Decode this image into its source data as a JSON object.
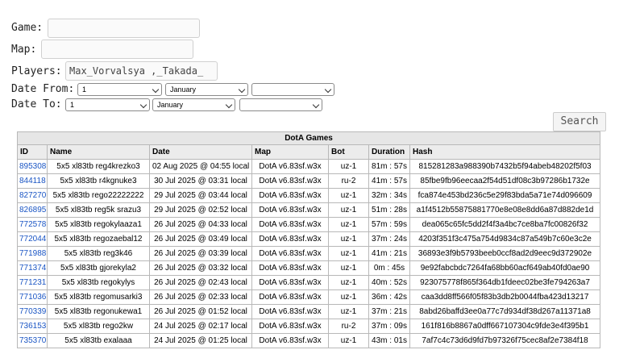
{
  "form": {
    "game_label": "Game:",
    "game_value": "",
    "map_label": "Map:",
    "map_value": "",
    "players_label": "Players:",
    "players_value": "Max_Vorvalsya ,_Takada_",
    "date_from_label": "Date From:",
    "date_from": {
      "day": "1",
      "month": "January",
      "year": ""
    },
    "date_to_label": "Date To:",
    "date_to": {
      "day": "1",
      "month": "January",
      "year": ""
    },
    "search_label": "Search"
  },
  "table": {
    "caption": "DotA Games",
    "headers": {
      "id": "ID",
      "name": "Name",
      "date": "Date",
      "map": "Map",
      "bot": "Bot",
      "duration": "Duration",
      "hash": "Hash"
    },
    "rows": [
      {
        "id": "895308",
        "name": "5x5 xl83tb reg4krezko3",
        "date": "02 Aug 2025 @ 04:55 local",
        "map": "DotA v6.83sf.w3x",
        "bot": "uz-1",
        "duration": "81m : 57s",
        "hash": "815281283a988390b7432b5f94abeb48202f5f03"
      },
      {
        "id": "844118",
        "name": "5x5 xl83tb r4kgnuke3",
        "date": "30 Jul 2025 @ 03:31 local",
        "map": "DotA v6.83sf.w3x",
        "bot": "ru-2",
        "duration": "41m : 57s",
        "hash": "85fbe9fb96eecaa2f54d51df08c3b97286b1732e"
      },
      {
        "id": "827270",
        "name": "5x5 xl83tb rego22222222",
        "date": "29 Jul 2025 @ 03:44 local",
        "map": "DotA v6.83sf.w3x",
        "bot": "uz-1",
        "duration": "32m : 34s",
        "hash": "fca874e453bd236c5e29f83bda5a71e74d096609"
      },
      {
        "id": "826895",
        "name": "5x5 xl83tb reg5k srazu3",
        "date": "29 Jul 2025 @ 02:52 local",
        "map": "DotA v6.83sf.w3x",
        "bot": "uz-1",
        "duration": "51m : 28s",
        "hash": "a1f4512b55875881770e8e08e8dd6a87d882de1d"
      },
      {
        "id": "772578",
        "name": "5x5 xl83tb regokylaaza1",
        "date": "26 Jul 2025 @ 04:33 local",
        "map": "DotA v6.83sf.w3x",
        "bot": "uz-1",
        "duration": "57m : 59s",
        "hash": "dea065c65fc5dd2f4f3a4bc7ce8ba7fc00826f32"
      },
      {
        "id": "772044",
        "name": "5x5 xl83tb regozaebal12",
        "date": "26 Jul 2025 @ 03:49 local",
        "map": "DotA v6.83sf.w3x",
        "bot": "uz-1",
        "duration": "37m : 24s",
        "hash": "4203f351f3c475a754d9834c87a549b7c60e3c2e"
      },
      {
        "id": "771988",
        "name": "5x5 xl83tb reg3k46",
        "date": "26 Jul 2025 @ 03:39 local",
        "map": "DotA v6.83sf.w3x",
        "bot": "uz-1",
        "duration": "41m : 21s",
        "hash": "36893e3f9b5793beeb0ccf8ad2d9eec9d372902e"
      },
      {
        "id": "771374",
        "name": "5x5 xl83tb gjorekyla2",
        "date": "26 Jul 2025 @ 03:32 local",
        "map": "DotA v6.83sf.w3x",
        "bot": "uz-1",
        "duration": "0m : 45s",
        "hash": "9e92fabcbdc7264fa68bb60acf649ab40fd0ae90"
      },
      {
        "id": "771231",
        "name": "5x5 xl83tb regokylys",
        "date": "26 Jul 2025 @ 02:43 local",
        "map": "DotA v6.83sf.w3x",
        "bot": "uz-1",
        "duration": "40m : 52s",
        "hash": "923075778f865f364db1fdeec02be3fe794263a7"
      },
      {
        "id": "771036",
        "name": "5x5 xl83tb regomusarki3",
        "date": "26 Jul 2025 @ 02:33 local",
        "map": "DotA v6.83sf.w3x",
        "bot": "uz-1",
        "duration": "36m : 42s",
        "hash": "caa3dd8ff566f05f83b3db2b0044fba423d13217"
      },
      {
        "id": "770339",
        "name": "5x5 xl83tb regonukewa1",
        "date": "26 Jul 2025 @ 01:52 local",
        "map": "DotA v6.83sf.w3x",
        "bot": "uz-1",
        "duration": "37m : 21s",
        "hash": "8abd26baffd3ee0a77c7d934df38d267a11371a8"
      },
      {
        "id": "736153",
        "name": "5x5 xl83tb rego2kw",
        "date": "24 Jul 2025 @ 02:17 local",
        "map": "DotA v6.83sf.w3x",
        "bot": "ru-2",
        "duration": "37m : 09s",
        "hash": "161f816b8867a0dff667107304c9fde3e4f395b1"
      },
      {
        "id": "735370",
        "name": "5x5 xl83tb exalaaa",
        "date": "24 Jul 2025 @ 01:25 local",
        "map": "DotA v6.83sf.w3x",
        "bot": "uz-1",
        "duration": "43m : 01s",
        "hash": "7af7c4c73d6d9fd7b97326f75cec8af2e7384f18"
      }
    ]
  },
  "colors": {
    "link": "#1a55c4",
    "header_bg": "#ececec",
    "border": "#b8b8b8"
  }
}
